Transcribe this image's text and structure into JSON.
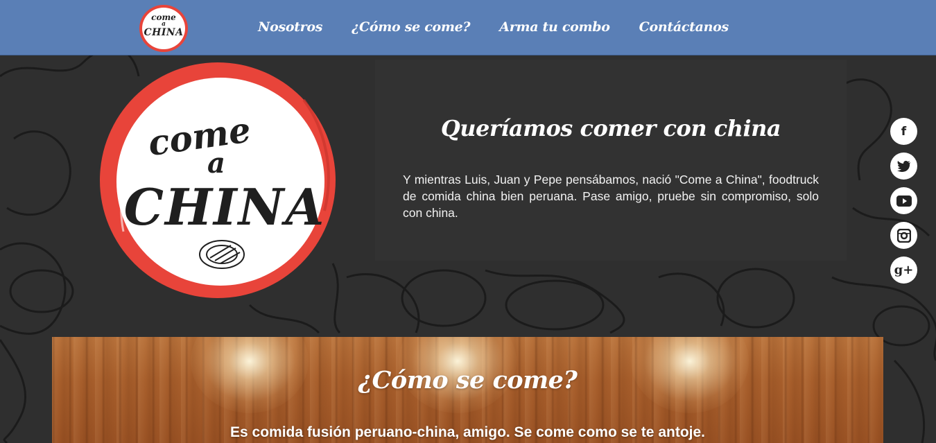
{
  "nav": {
    "logo": {
      "line1": "come",
      "line2": "a",
      "line3": "CHINA"
    },
    "items": [
      {
        "label": "Nosotros"
      },
      {
        "label": "¿Cómo se come?"
      },
      {
        "label": "Arma tu combo"
      },
      {
        "label": "Contáctanos"
      }
    ]
  },
  "hero": {
    "logo": {
      "line1": "come",
      "line2": "a",
      "line3": "CHINA"
    },
    "title": "Queríamos comer con china",
    "text": "Y mientras Luis, Juan y Pepe pensábamos, nació \"Come a China\", foodtruck de comida china bien peruana. Pase amigo, pruebe sin compromiso, solo con china."
  },
  "social": [
    {
      "icon": "facebook-icon",
      "glyph": "f"
    },
    {
      "icon": "twitter-icon",
      "glyph": "🐦"
    },
    {
      "icon": "youtube-icon",
      "glyph": "▶"
    },
    {
      "icon": "instagram-icon",
      "glyph": "◘"
    },
    {
      "icon": "google-plus-icon",
      "glyph": "g+"
    }
  ],
  "how": {
    "title": "¿Cómo se come?",
    "text": "Es comida fusión peruano-china, amigo. Se come como se te antoje."
  },
  "colors": {
    "navbar": "#5a7fb6",
    "logo_ring": "#e8443a",
    "background": "#2f2f2f",
    "wood": "#a85f2c"
  }
}
